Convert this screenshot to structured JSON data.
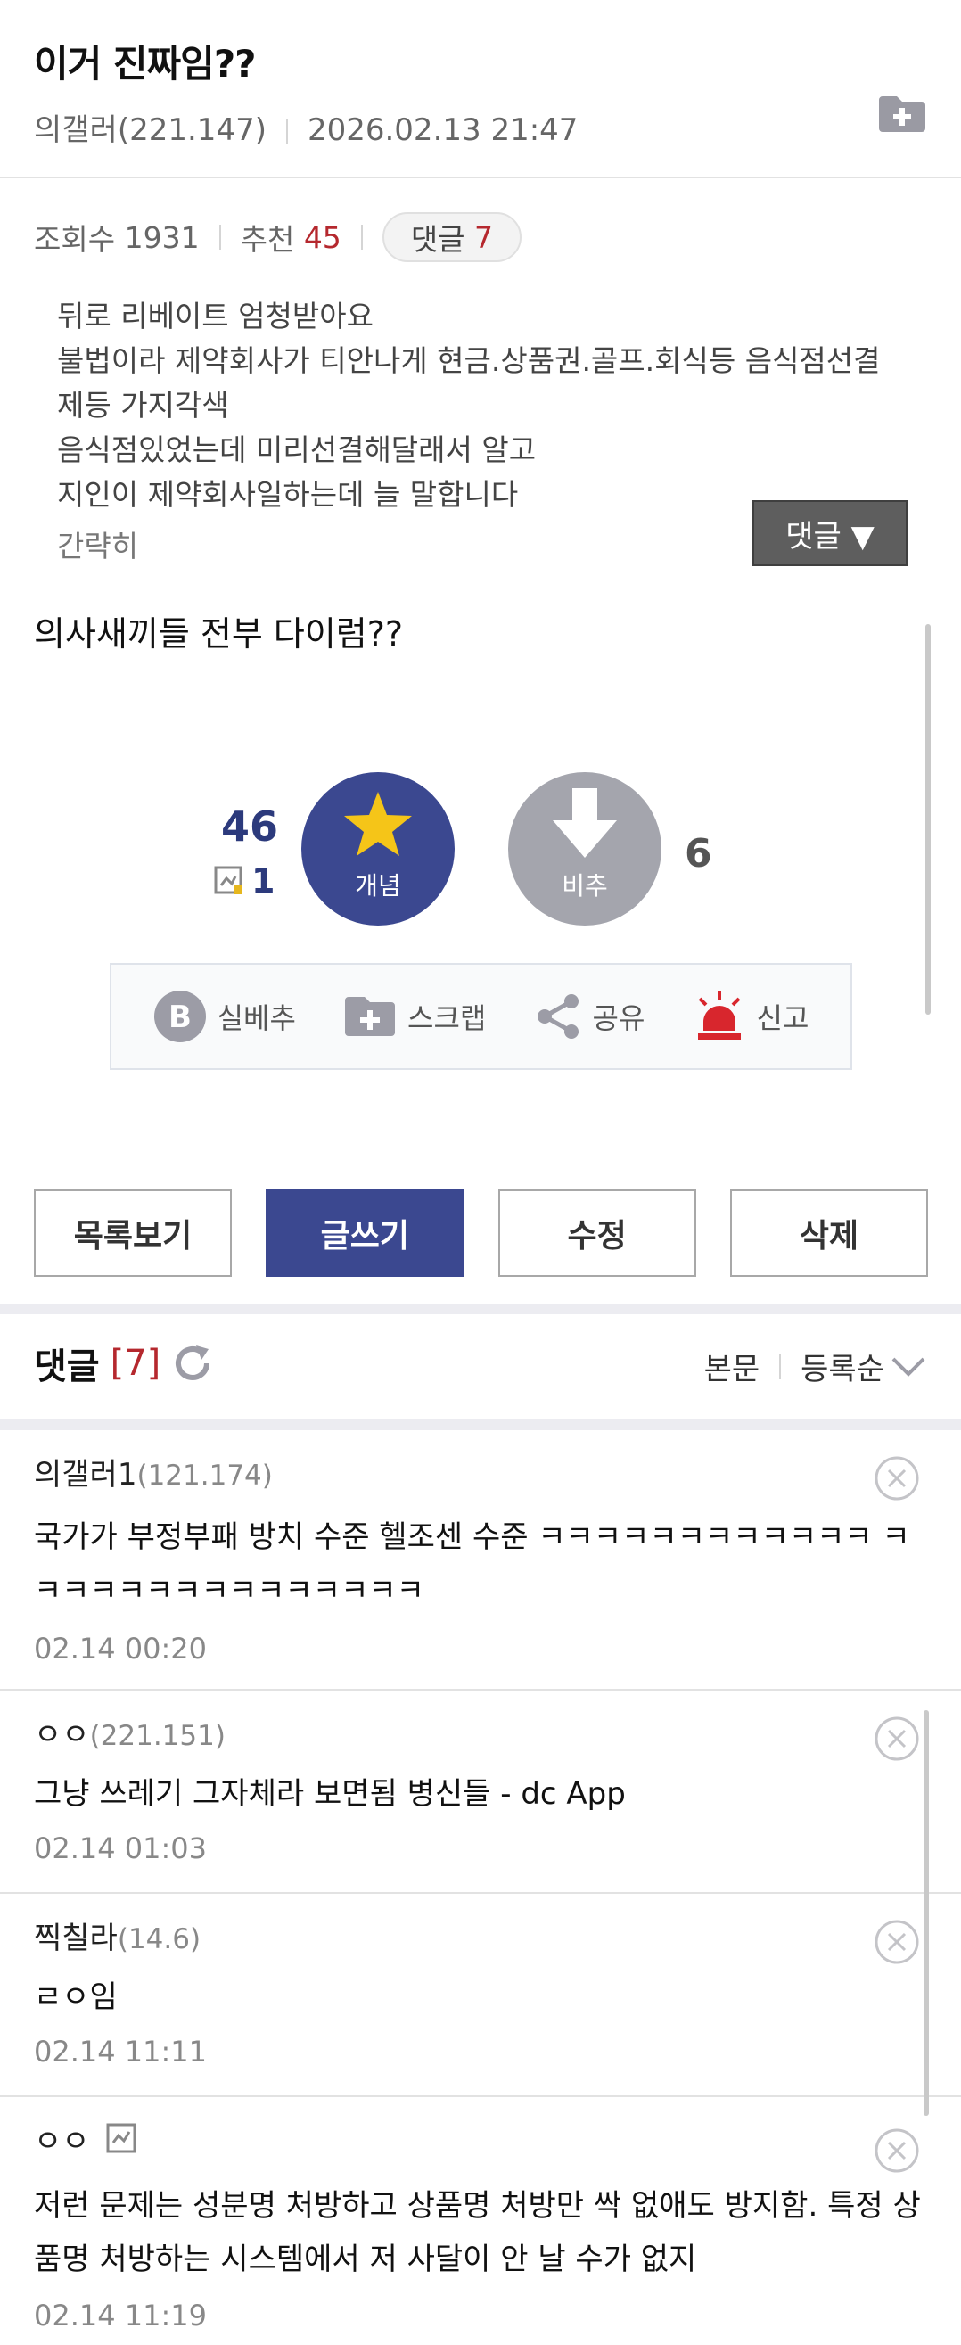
{
  "post": {
    "title": "이거 진짜임??",
    "author": "의갤러(221.147)",
    "date": "2026.02.13 21:47"
  },
  "stats": {
    "views_label": "조회수",
    "views": "1931",
    "recommend_label": "추천",
    "recommend": "45",
    "comment_label": "댓글",
    "comment_count": "7"
  },
  "preview": {
    "lines": [
      "뒤로 리베이트 엄청받아요",
      "불법이라 제약회사가 티안나게 현금.상품권.골프.회식등 음식점선결",
      "제등 가지각색",
      "음식점있었는데 미리선결해달래서 알고",
      "지인이 제약회사일하는데 늘 말합니다"
    ],
    "more_label": "간략히",
    "toggle_label": "댓글 ▼"
  },
  "body": {
    "text": "의사새끼들 전부 다이럼??"
  },
  "votes": {
    "up_count": "46",
    "up_fixed": "1",
    "up_label": "개념",
    "down_label": "비추",
    "down_count": "6"
  },
  "actions": {
    "best": "실베추",
    "scrap": "스크랩",
    "share": "공유",
    "report": "신고"
  },
  "buttons": {
    "list": "목록보기",
    "write": "글쓰기",
    "edit": "수정",
    "delete": "삭제"
  },
  "comments_section": {
    "title": "댓글",
    "count": "[7]",
    "sort_body": "본문",
    "sort_order": "등록순"
  },
  "comments": [
    {
      "nick": "의갤러1",
      "ip": "(121.174)",
      "text": "국가가 부정부패 방치 수준 헬조센 수준 ㅋㅋㅋㅋㅋㅋㅋㅋㅋㅋㅋㅋ ㅋㅋㅋㅋㅋㅋㅋㅋㅋㅋㅋㅋㅋㅋㅋ",
      "time": "02.14 00:20"
    },
    {
      "nick": "ㅇㅇ",
      "ip": "(221.151)",
      "text": "그냥 쓰레기 그자체라 보면됨 병신들 - dc App",
      "time": "02.14 01:03"
    },
    {
      "nick": "찍칠라",
      "ip": "(14.6)",
      "text": "ㄹㅇ임",
      "time": "02.14 11:11"
    },
    {
      "nick": "ㅇㅇ",
      "ip": "",
      "text": "저런 문제는 성분명 처방하고 상품명 처방만 싹 없애도 방지함. 특정 상품명 처방하는 시스템에서 저 사달이 안 날 수가 없지",
      "time": "02.14 11:19"
    }
  ],
  "colors": {
    "brand": "#3b4890",
    "accent_red": "#b5282e",
    "downvote": "#a4a5ad"
  }
}
